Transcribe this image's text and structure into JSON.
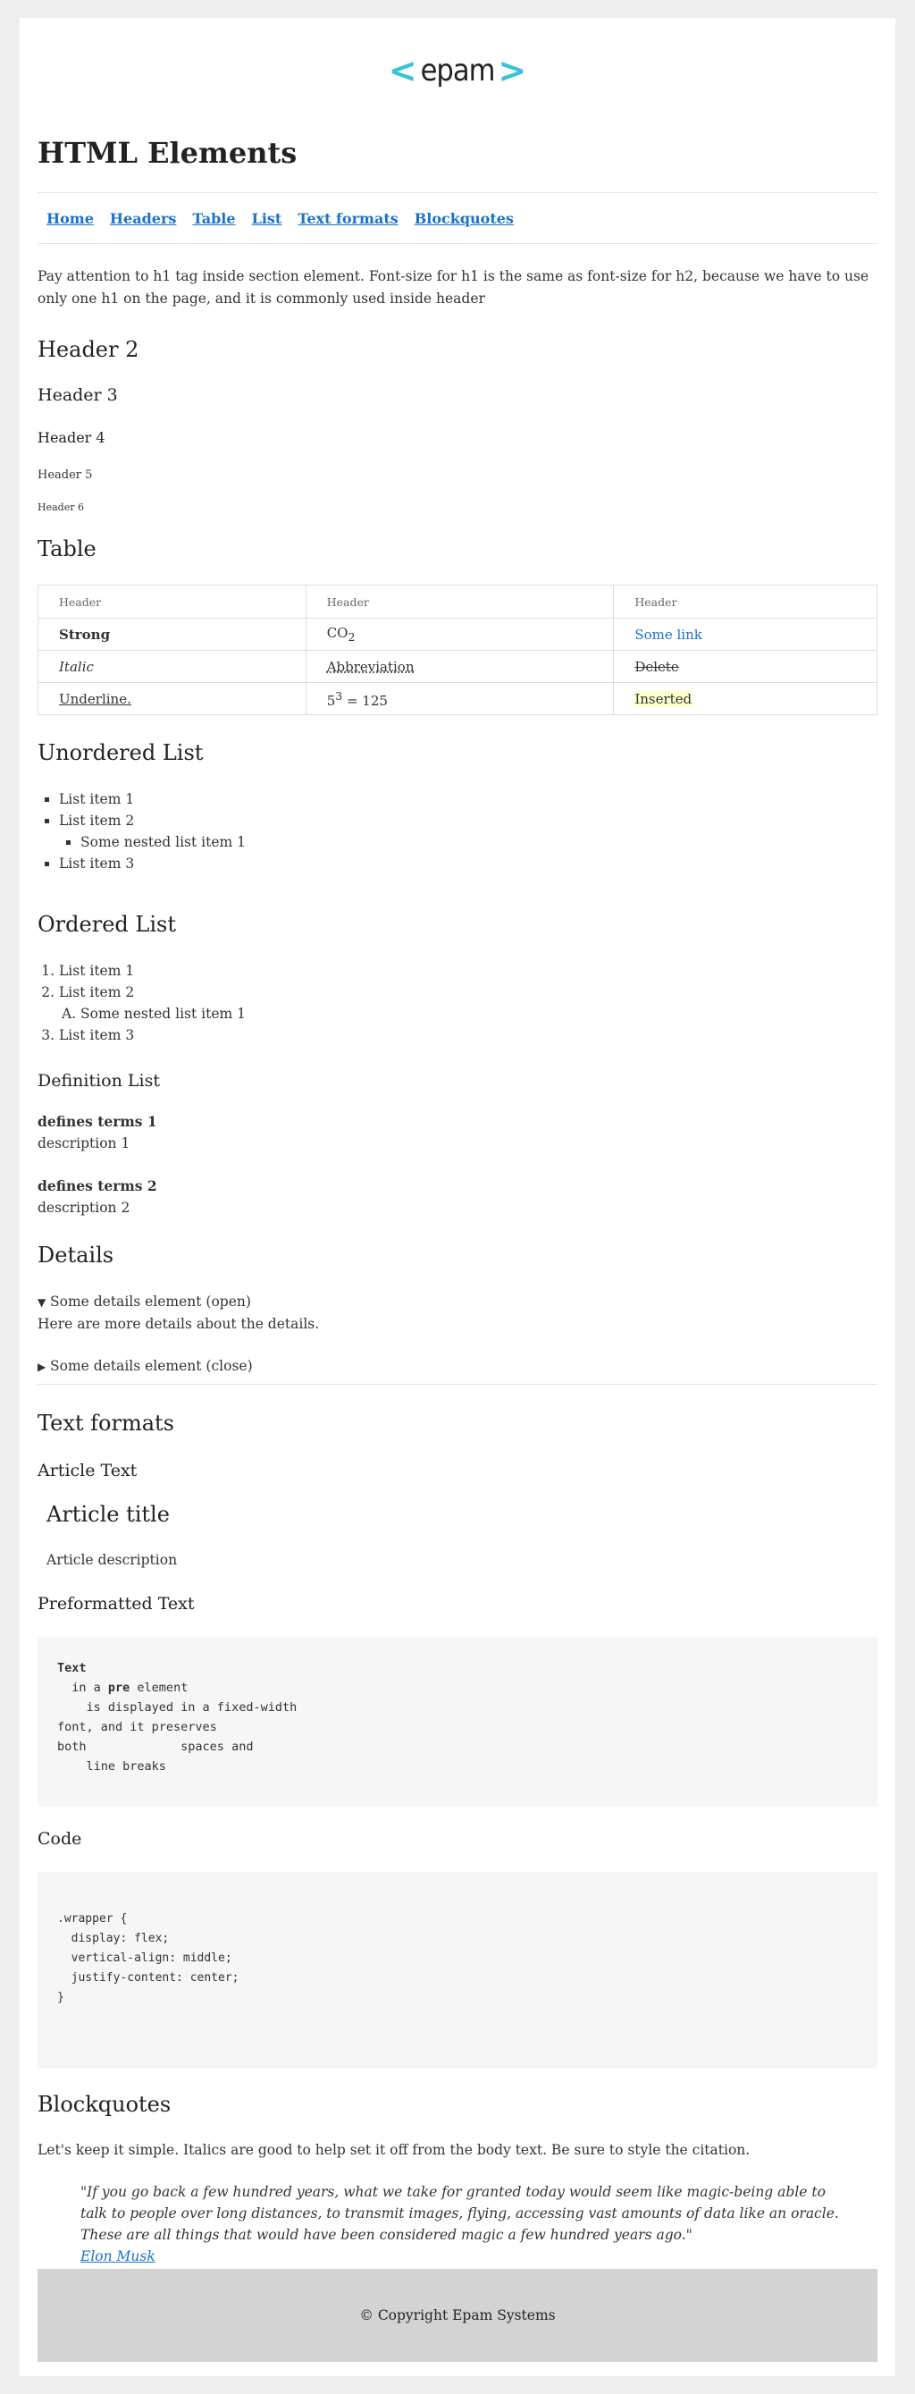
{
  "logo": {
    "text": "epam",
    "left": "<",
    "right": ">"
  },
  "page_title": "HTML Elements",
  "nav": [
    "Home",
    "Headers",
    "Table",
    "List",
    "Text formats",
    "Blockquotes"
  ],
  "intro": "Pay attention to h1 tag inside section element. Font-size for h1 is the same as font-size for h2, because we have to use only one h1 on the page, and it is commonly used inside header",
  "headers": {
    "h2": "Header 2",
    "h3": "Header 3",
    "h4": "Header 4",
    "h5": "Header 5",
    "h6": "Header 6"
  },
  "table": {
    "heading": "Table",
    "columns": [
      "Header",
      "Header",
      "Header"
    ],
    "strong": "Strong",
    "co_main": "CO",
    "co_sub": "2",
    "link": "Some link",
    "italic": "Italic",
    "abbr": "Abbreviation",
    "deleted": "Delete",
    "underline": "Underline.",
    "pow_base": "5",
    "pow_exp": "3",
    "pow_rest": " = 125",
    "inserted": "Inserted"
  },
  "unordered": {
    "heading": "Unordered List",
    "item1": "List item 1",
    "item2": "List item 2",
    "nested1": "Some nested list item 1",
    "item3": "List item 3"
  },
  "ordered": {
    "heading": "Ordered List",
    "item1": "List item 1",
    "item2": "List item 2",
    "nested1": "Some nested list item 1",
    "item3": "List item 3"
  },
  "definition": {
    "heading": "Definition List",
    "term1": "defines terms 1",
    "desc1": "description 1",
    "term2": "defines terms 2",
    "desc2": "description 2"
  },
  "details": {
    "heading": "Details",
    "open_summary": "Some details element (open)",
    "open_body": "Here are more details about the details.",
    "closed_summary": "Some details element (close)"
  },
  "text_formats": {
    "heading": "Text formats",
    "article_heading": "Article Text",
    "article_title": "Article title",
    "article_desc": "Article description",
    "pre_heading": "Preformatted Text",
    "pre_bold": "Text",
    "pre_line1_a": "  in a ",
    "pre_line1_b": "pre",
    "pre_line1_c": " element",
    "pre_rest": "    is displayed in a fixed-width\nfont, and it preserves\nboth             spaces and\n    line breaks",
    "code_heading": "Code",
    "code": ".wrapper {\n  display: flex;\n  vertical-align: middle;\n  justify-content: center;\n}"
  },
  "blockquotes": {
    "heading": "Blockquotes",
    "lead": "Let's keep it simple. Italics are good to help set it off from the body text. Be sure to style the citation.",
    "quote": "\"If you go back a few hundred years, what we take for granted today would seem like magic-being able to talk to people over long distances, to transmit images, flying, accessing vast amounts of data like an oracle. These are all things that would have been considered magic a few hundred years ago.\"",
    "cite": "Elon Musk"
  },
  "footer": "© Copyright Epam Systems",
  "colors": {
    "link": "#1a73c8",
    "logo_accent": "#39c2d7",
    "footer_bg": "#d3d3d3",
    "page_bg": "#eeeeee"
  }
}
